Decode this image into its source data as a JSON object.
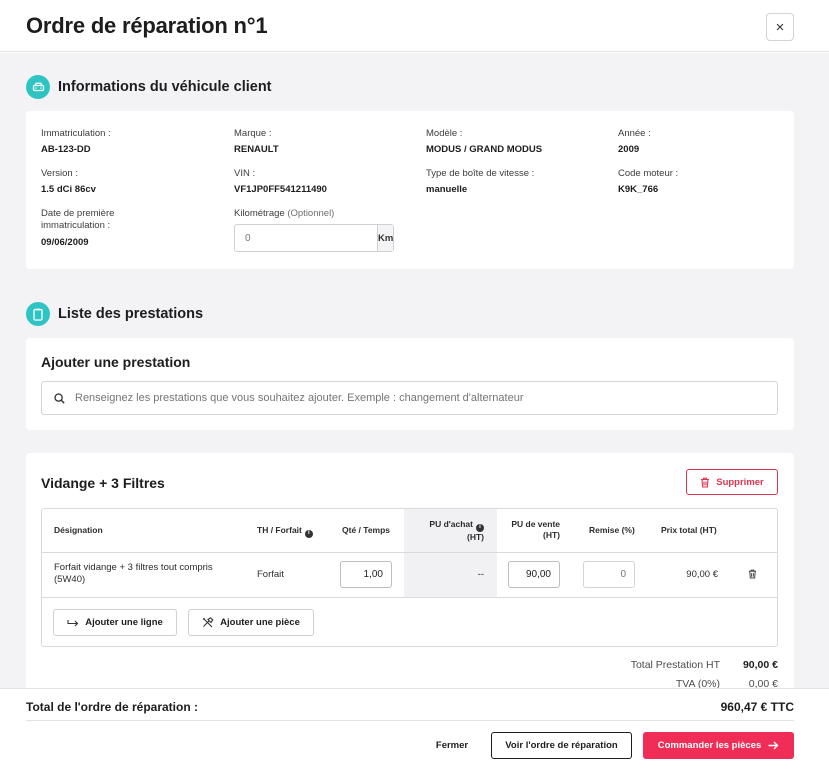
{
  "header": {
    "title": "Ordre de réparation n°1",
    "close_label": "×"
  },
  "vehicle_section": {
    "title": "Informations du véhicule client",
    "icon": "car-icon",
    "fields": {
      "immatriculation": {
        "label": "Immatriculation :",
        "value": "AB-123-DD"
      },
      "marque": {
        "label": "Marque :",
        "value": "RENAULT"
      },
      "modele": {
        "label": "Modèle :",
        "value": "MODUS / GRAND MODUS"
      },
      "annee": {
        "label": "Année :",
        "value": "2009"
      },
      "version": {
        "label": "Version :",
        "value": "1.5 dCi 86cv"
      },
      "vin": {
        "label": "VIN :",
        "value": "VF1JP0FF541211490"
      },
      "boite": {
        "label": "Type de boîte de vitesse :",
        "value": "manuelle"
      },
      "code_moteur": {
        "label": "Code moteur :",
        "value": "K9K_766"
      },
      "date_immat": {
        "label": "Date de première immatriculation :",
        "value": "09/06/2009"
      }
    },
    "kilometrage": {
      "label": "Kilométrage",
      "optional": "(Optionnel)",
      "placeholder": "0",
      "unit": "Km"
    }
  },
  "prestations_section": {
    "title": "Liste des prestations",
    "icon": "clipboard-icon",
    "add": {
      "title": "Ajouter une prestation",
      "search_placeholder": "Renseignez les prestations que vous souhaitez ajouter. Exemple : changement d'alternateur"
    },
    "prestation": {
      "title": "Vidange + 3 Filtres",
      "delete_label": "Supprimer",
      "columns": {
        "designation": "Désignation",
        "th_forfait": "TH / Forfait",
        "qte": "Qté / Temps",
        "pu_achat_1": "PU d'achat",
        "pu_achat_2": "(HT)",
        "pu_vente_1": "PU de vente",
        "pu_vente_2": "(HT)",
        "remise": "Remise (%)",
        "prix_total": "Prix total (HT)"
      },
      "row": {
        "designation": "Forfait vidange + 3 filtres tout compris (5W40)",
        "th_forfait": "Forfait",
        "qte": "1,00",
        "pu_achat": "--",
        "pu_vente": "90,00",
        "remise_placeholder": "0",
        "prix_total": "90,00 €"
      },
      "add_line_label": "Ajouter une ligne",
      "add_part_label": "Ajouter une pièce"
    },
    "totals": {
      "ht_label": "Total Prestation HT",
      "ht_value": "90,00 €",
      "tva_label": "TVA (0%)",
      "tva_value": "0,00 €"
    }
  },
  "footer": {
    "total_label": "Total de l'ordre de réparation :",
    "total_value": "960,47 € TTC",
    "close_label": "Fermer",
    "view_label": "Voir l'ordre de réparation",
    "order_label": "Commander les pièces"
  },
  "colors": {
    "accent_teal": "#2ec4c4",
    "danger_red": "#e0334e",
    "primary_pink": "#ef2d56"
  }
}
